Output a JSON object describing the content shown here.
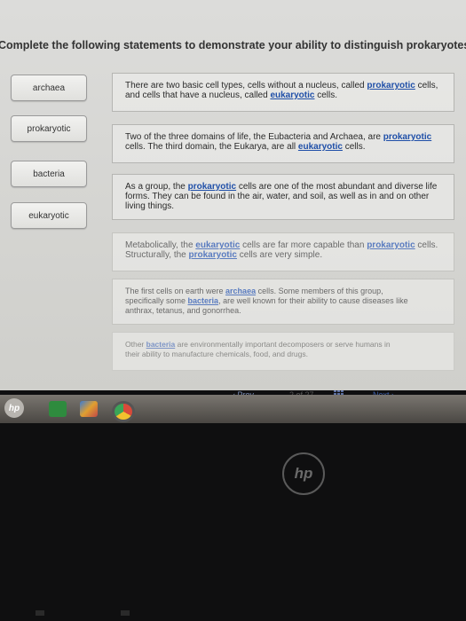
{
  "instruction": "Complete the following statements to demonstrate your ability to distinguish prokaryotes from eukaryote",
  "labels": [
    "archaea",
    "prokaryotic",
    "bacteria",
    "eukaryotic"
  ],
  "statements": [
    {
      "line1_pre": "There are two basic cell types, cells without a nucleus, called ",
      "line1_kw": "prokaryotic",
      "line1_post": " cells,",
      "line2_pre": "and cells that have a nucleus, called ",
      "line2_kw": "eukaryotic",
      "line2_post": " cells."
    },
    {
      "line1_pre": "Two of the three domains of life, the Eubacteria and Archaea, are ",
      "line1_kw": "prokaryotic",
      "line1_post": "",
      "line2_pre": "cells. The third domain, the Eukarya, are all ",
      "line2_kw": "eukaryotic",
      "line2_post": " cells."
    },
    {
      "line1_pre": "As a group, the ",
      "line1_kw": "prokaryotic",
      "line1_post": " cells are one of the most abundant and diverse life",
      "line2": "forms. They can be found in the air, water, and soil, as well as in and on other",
      "line3": "living things."
    },
    {
      "line1_pre": "Metabolically, the ",
      "line1_kw": "eukaryotic",
      "line1_post": " cells are far more capable than ",
      "line1_kw2": "prokaryotic",
      "line1_post2": " cells.",
      "line2_pre": "Structurally, the ",
      "line2_kw": "prokaryotic",
      "line2_post": " cells are very simple."
    },
    {
      "line1_pre": "The first cells on earth were ",
      "line1_kw": "archaea",
      "line1_post": " cells. Some members of this group,",
      "line2_pre": "specifically some ",
      "line2_kw": "bacteria",
      "line2_post": ", are well known for their ability to cause diseases like",
      "line3": "anthrax, tetanus, and gonorrhea."
    },
    {
      "line1_pre": "Other ",
      "line1_kw": "bacteria",
      "line1_post": " are environmentally important decomposers or serve humans in",
      "line2": "their ability to manufacture chemicals, food, and drugs."
    }
  ],
  "pager": {
    "prev": "‹  Prev",
    "count": "2 of 27",
    "next": "Next  ›"
  },
  "icons": [
    "hp-logo-icon",
    "file-icon",
    "photos-icon",
    "chrome-icon",
    "grid-icon"
  ],
  "colors": {
    "keyword": "#1f4fa8",
    "screen_bg": "#d8d8d5",
    "bezel": "#0f0f10"
  }
}
